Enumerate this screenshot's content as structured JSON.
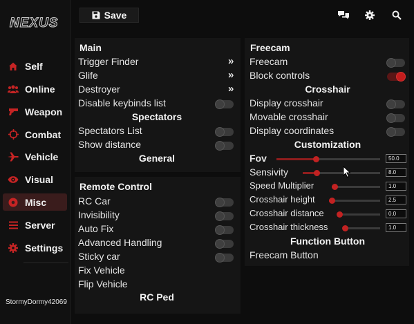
{
  "sidebar": {
    "logo": "Nexus",
    "items": [
      {
        "label": "Self",
        "icon": "home-icon"
      },
      {
        "label": "Online",
        "icon": "users-icon"
      },
      {
        "label": "Weapon",
        "icon": "gun-icon"
      },
      {
        "label": "Combat",
        "icon": "crosshair-icon"
      },
      {
        "label": "Vehicle",
        "icon": "plane-icon"
      },
      {
        "label": "Visual",
        "icon": "eye-icon"
      },
      {
        "label": "Misc",
        "icon": "misc-icon"
      },
      {
        "label": "Server",
        "icon": "list-icon"
      },
      {
        "label": "Settings",
        "icon": "gear-icon"
      }
    ],
    "active": "Misc",
    "username": "StormyDormy42069"
  },
  "topbar": {
    "save_label": "Save",
    "icons": [
      "chat-icon",
      "settings-icon",
      "search-icon"
    ]
  },
  "colors": {
    "accent": "#c21d1d",
    "bg": "#0d0d0d",
    "panel": "#151515",
    "toggle_off": "#3a3a3a"
  },
  "left_panel": {
    "main_title": "Main",
    "main_items": [
      {
        "label": "Trigger Finder",
        "kind": "submenu",
        "chev": "»"
      },
      {
        "label": "Glife",
        "kind": "submenu",
        "chev": "»"
      },
      {
        "label": "Destroyer",
        "kind": "submenu",
        "chev": "»"
      },
      {
        "label": "Disable keybinds list",
        "kind": "toggle",
        "on": false
      }
    ],
    "spectators_title": "Spectators",
    "spectators_items": [
      {
        "label": "Spectators List",
        "kind": "toggle",
        "on": false
      },
      {
        "label": "Show distance",
        "kind": "toggle",
        "on": false
      }
    ],
    "general_title": "General",
    "remote_title": "Remote Control",
    "remote_items": [
      {
        "label": "RC Car",
        "kind": "toggle",
        "on": false
      },
      {
        "label": "Invisibility",
        "kind": "toggle",
        "on": false
      },
      {
        "label": "Auto Fix",
        "kind": "toggle",
        "on": false
      },
      {
        "label": "Advanced Handling",
        "kind": "toggle",
        "on": false
      },
      {
        "label": "Sticky car",
        "kind": "toggle",
        "on": false
      },
      {
        "label": "Fix Vehicle",
        "kind": "button"
      },
      {
        "label": "Flip Vehicle",
        "kind": "button"
      }
    ],
    "rcped_title": "RC Ped"
  },
  "right_panel": {
    "freecam_title": "Freecam",
    "freecam_items": [
      {
        "label": "Freecam",
        "on": false
      },
      {
        "label": "Block controls",
        "on": true
      }
    ],
    "crosshair_title": "Crosshair",
    "crosshair_items": [
      {
        "label": "Display crosshair",
        "on": false
      },
      {
        "label": "Movable crosshair",
        "on": false
      },
      {
        "label": "Display coordinates",
        "on": false
      }
    ],
    "custom_title": "Customization",
    "sliders": [
      {
        "label": "Fov",
        "value": "50.0",
        "level": 0.38
      },
      {
        "label": "Sensivity",
        "value": "8.0",
        "level": 0.18
      },
      {
        "label": "Speed Multiplier",
        "value": "1.0",
        "level": 0.05
      },
      {
        "label": "Crosshair height",
        "value": "2.5",
        "level": 0.05
      },
      {
        "label": "Crosshair distance",
        "value": "0.0",
        "level": 0.05
      },
      {
        "label": "Crosshair thickness",
        "value": "1.0",
        "level": 0.05
      }
    ],
    "function_title": "Function Button",
    "function_item": "Freecam Button"
  }
}
